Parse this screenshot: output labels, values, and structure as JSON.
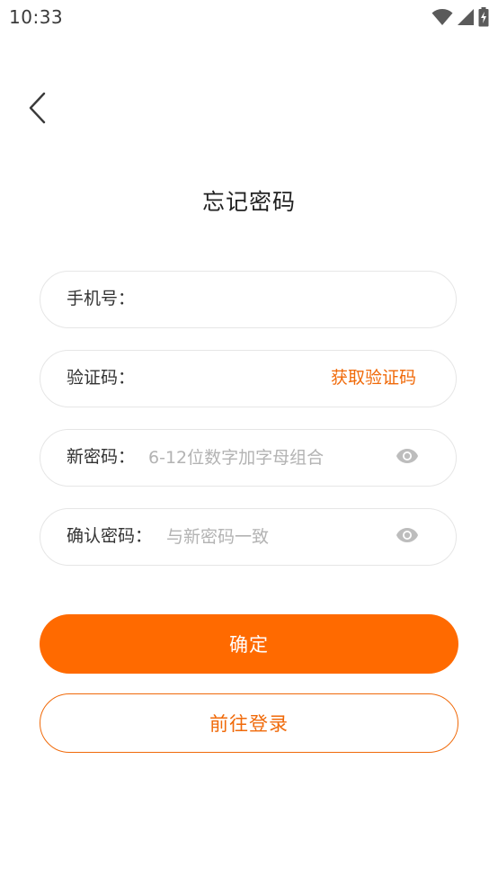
{
  "status_bar": {
    "time": "10:33",
    "icons": [
      "wifi-icon",
      "cellular-signal-icon",
      "battery-charging-icon"
    ]
  },
  "nav": {
    "back_icon": "chevron-left-icon"
  },
  "title": "忘记密码",
  "form": {
    "phone": {
      "label": "手机号：",
      "value": "",
      "placeholder": ""
    },
    "code": {
      "label": "验证码：",
      "value": "",
      "placeholder": "",
      "get_code_label": "获取验证码"
    },
    "new_password": {
      "label": "新密码：",
      "value": "",
      "placeholder": "6-12位数字加字母组合",
      "toggle_icon": "eye-icon"
    },
    "confirm_password": {
      "label": "确认密码：",
      "value": "",
      "placeholder": "与新密码一致",
      "toggle_icon": "eye-icon"
    }
  },
  "buttons": {
    "confirm_label": "确定",
    "login_label": "前往登录"
  },
  "colors": {
    "accent": "#ff6a00",
    "accent_text": "#f06a0a",
    "field_border": "#e6e6e6",
    "placeholder": "#b3b3b3",
    "label": "#333333",
    "icon_gray": "#bdbdbd"
  }
}
